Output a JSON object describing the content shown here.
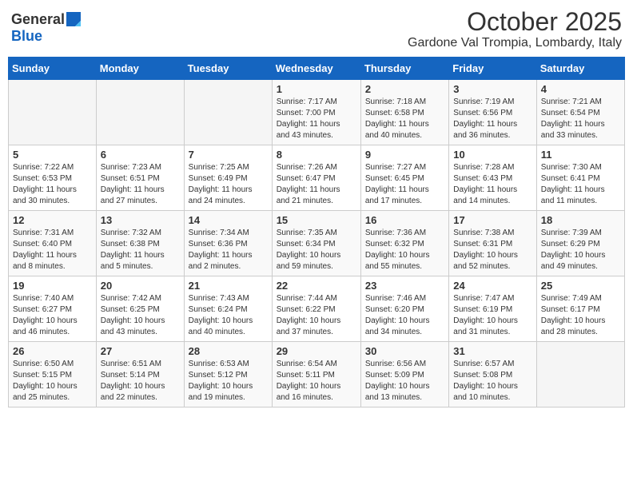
{
  "header": {
    "logo_general": "General",
    "logo_blue": "Blue",
    "month": "October 2025",
    "location": "Gardone Val Trompia, Lombardy, Italy"
  },
  "days_of_week": [
    "Sunday",
    "Monday",
    "Tuesday",
    "Wednesday",
    "Thursday",
    "Friday",
    "Saturday"
  ],
  "weeks": [
    [
      {
        "day": "",
        "info": ""
      },
      {
        "day": "",
        "info": ""
      },
      {
        "day": "",
        "info": ""
      },
      {
        "day": "1",
        "info": "Sunrise: 7:17 AM\nSunset: 7:00 PM\nDaylight: 11 hours\nand 43 minutes."
      },
      {
        "day": "2",
        "info": "Sunrise: 7:18 AM\nSunset: 6:58 PM\nDaylight: 11 hours\nand 40 minutes."
      },
      {
        "day": "3",
        "info": "Sunrise: 7:19 AM\nSunset: 6:56 PM\nDaylight: 11 hours\nand 36 minutes."
      },
      {
        "day": "4",
        "info": "Sunrise: 7:21 AM\nSunset: 6:54 PM\nDaylight: 11 hours\nand 33 minutes."
      }
    ],
    [
      {
        "day": "5",
        "info": "Sunrise: 7:22 AM\nSunset: 6:53 PM\nDaylight: 11 hours\nand 30 minutes."
      },
      {
        "day": "6",
        "info": "Sunrise: 7:23 AM\nSunset: 6:51 PM\nDaylight: 11 hours\nand 27 minutes."
      },
      {
        "day": "7",
        "info": "Sunrise: 7:25 AM\nSunset: 6:49 PM\nDaylight: 11 hours\nand 24 minutes."
      },
      {
        "day": "8",
        "info": "Sunrise: 7:26 AM\nSunset: 6:47 PM\nDaylight: 11 hours\nand 21 minutes."
      },
      {
        "day": "9",
        "info": "Sunrise: 7:27 AM\nSunset: 6:45 PM\nDaylight: 11 hours\nand 17 minutes."
      },
      {
        "day": "10",
        "info": "Sunrise: 7:28 AM\nSunset: 6:43 PM\nDaylight: 11 hours\nand 14 minutes."
      },
      {
        "day": "11",
        "info": "Sunrise: 7:30 AM\nSunset: 6:41 PM\nDaylight: 11 hours\nand 11 minutes."
      }
    ],
    [
      {
        "day": "12",
        "info": "Sunrise: 7:31 AM\nSunset: 6:40 PM\nDaylight: 11 hours\nand 8 minutes."
      },
      {
        "day": "13",
        "info": "Sunrise: 7:32 AM\nSunset: 6:38 PM\nDaylight: 11 hours\nand 5 minutes."
      },
      {
        "day": "14",
        "info": "Sunrise: 7:34 AM\nSunset: 6:36 PM\nDaylight: 11 hours\nand 2 minutes."
      },
      {
        "day": "15",
        "info": "Sunrise: 7:35 AM\nSunset: 6:34 PM\nDaylight: 10 hours\nand 59 minutes."
      },
      {
        "day": "16",
        "info": "Sunrise: 7:36 AM\nSunset: 6:32 PM\nDaylight: 10 hours\nand 55 minutes."
      },
      {
        "day": "17",
        "info": "Sunrise: 7:38 AM\nSunset: 6:31 PM\nDaylight: 10 hours\nand 52 minutes."
      },
      {
        "day": "18",
        "info": "Sunrise: 7:39 AM\nSunset: 6:29 PM\nDaylight: 10 hours\nand 49 minutes."
      }
    ],
    [
      {
        "day": "19",
        "info": "Sunrise: 7:40 AM\nSunset: 6:27 PM\nDaylight: 10 hours\nand 46 minutes."
      },
      {
        "day": "20",
        "info": "Sunrise: 7:42 AM\nSunset: 6:25 PM\nDaylight: 10 hours\nand 43 minutes."
      },
      {
        "day": "21",
        "info": "Sunrise: 7:43 AM\nSunset: 6:24 PM\nDaylight: 10 hours\nand 40 minutes."
      },
      {
        "day": "22",
        "info": "Sunrise: 7:44 AM\nSunset: 6:22 PM\nDaylight: 10 hours\nand 37 minutes."
      },
      {
        "day": "23",
        "info": "Sunrise: 7:46 AM\nSunset: 6:20 PM\nDaylight: 10 hours\nand 34 minutes."
      },
      {
        "day": "24",
        "info": "Sunrise: 7:47 AM\nSunset: 6:19 PM\nDaylight: 10 hours\nand 31 minutes."
      },
      {
        "day": "25",
        "info": "Sunrise: 7:49 AM\nSunset: 6:17 PM\nDaylight: 10 hours\nand 28 minutes."
      }
    ],
    [
      {
        "day": "26",
        "info": "Sunrise: 6:50 AM\nSunset: 5:15 PM\nDaylight: 10 hours\nand 25 minutes."
      },
      {
        "day": "27",
        "info": "Sunrise: 6:51 AM\nSunset: 5:14 PM\nDaylight: 10 hours\nand 22 minutes."
      },
      {
        "day": "28",
        "info": "Sunrise: 6:53 AM\nSunset: 5:12 PM\nDaylight: 10 hours\nand 19 minutes."
      },
      {
        "day": "29",
        "info": "Sunrise: 6:54 AM\nSunset: 5:11 PM\nDaylight: 10 hours\nand 16 minutes."
      },
      {
        "day": "30",
        "info": "Sunrise: 6:56 AM\nSunset: 5:09 PM\nDaylight: 10 hours\nand 13 minutes."
      },
      {
        "day": "31",
        "info": "Sunrise: 6:57 AM\nSunset: 5:08 PM\nDaylight: 10 hours\nand 10 minutes."
      },
      {
        "day": "",
        "info": ""
      }
    ]
  ]
}
